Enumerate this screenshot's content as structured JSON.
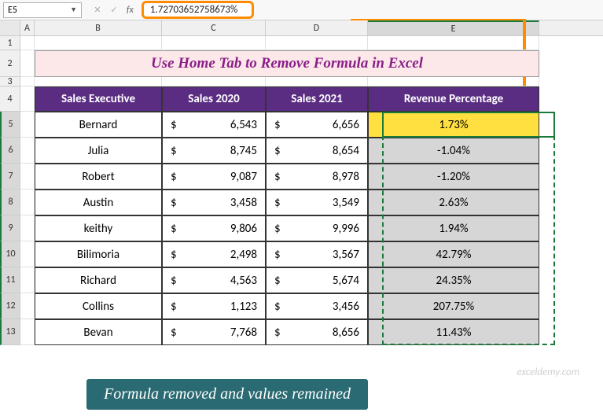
{
  "name_box": "E5",
  "formula_bar": "1.72703652758673%",
  "columns": [
    "A",
    "B",
    "C",
    "D",
    "E"
  ],
  "row_nums": [
    "1",
    "2",
    "3",
    "4",
    "5",
    "6",
    "7",
    "8",
    "9",
    "10",
    "11",
    "12",
    "13"
  ],
  "title": "Use Home Tab to Remove Formula in Excel",
  "headers": {
    "exec": "Sales Executive",
    "s2020": "Sales 2020",
    "s2021": "Sales 2021",
    "rev": "Revenue Percentage"
  },
  "currency": "$",
  "rows": [
    {
      "exec": "Bernard",
      "s2020": "6,543",
      "s2021": "6,656",
      "rev": "1.73%"
    },
    {
      "exec": "Julia",
      "s2020": "8,745",
      "s2021": "8,654",
      "rev": "-1.04%"
    },
    {
      "exec": "Robert",
      "s2020": "9,087",
      "s2021": "8,978",
      "rev": "-1.20%"
    },
    {
      "exec": "Austin",
      "s2020": "3,458",
      "s2021": "3,549",
      "rev": "2.63%"
    },
    {
      "exec": "keithy",
      "s2020": "9,806",
      "s2021": "9,996",
      "rev": "1.94%"
    },
    {
      "exec": "Bilimoria",
      "s2020": "2,498",
      "s2021": "3,567",
      "rev": "42.79%"
    },
    {
      "exec": "Richard",
      "s2020": "4,563",
      "s2021": "5,674",
      "rev": "24.35%"
    },
    {
      "exec": "Collins",
      "s2020": "1,123",
      "s2021": "3,456",
      "rev": "207.75%"
    },
    {
      "exec": "Bevan",
      "s2020": "7,768",
      "s2021": "8,656",
      "rev": "11.43%"
    }
  ],
  "callout": "Formula removed and values remained",
  "watermark": "exceldemy.com"
}
